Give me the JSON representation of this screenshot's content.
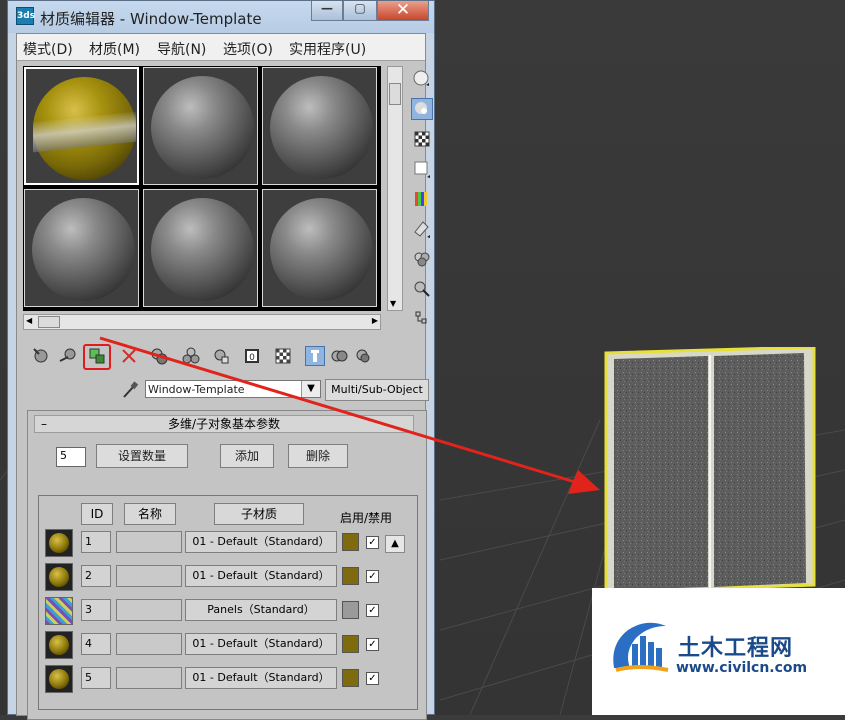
{
  "window": {
    "title": "材质编辑器 - Window-Template",
    "app_icon_text": "3ds",
    "minimize_label": "—",
    "maximize_label": "▢",
    "close_label": "✕"
  },
  "menu": [
    {
      "label": "模式(D)"
    },
    {
      "label": "材质(M)"
    },
    {
      "label": "导航(N)"
    },
    {
      "label": "选项(O)"
    },
    {
      "label": "实用程序(U)"
    }
  ],
  "sample_slots": [
    {
      "material": "gold",
      "selected": true
    },
    {
      "material": "gray",
      "selected": false
    },
    {
      "material": "gray",
      "selected": false
    },
    {
      "material": "gray",
      "selected": false
    },
    {
      "material": "gray",
      "selected": false
    },
    {
      "material": "gray",
      "selected": false
    }
  ],
  "side_toolbar": [
    "sample-type-icon",
    "backlight-icon",
    "background-icon",
    "tiling-icon",
    "video-color-check-icon",
    "make-preview-icon",
    "options-icon",
    "select-by-material-icon",
    "material-map-navigator-icon"
  ],
  "horizontal_toolbar": [
    "get-material-icon",
    "put-to-scene-icon",
    "assign-to-selection-icon",
    "reset-map-icon",
    "copy-material-icon",
    "make-unique-icon",
    "put-to-library-icon",
    "material-id-channel-icon",
    "show-map-icon",
    "show-end-result-icon",
    "go-to-parent-icon",
    "go-forward-icon"
  ],
  "material_name": "Window-Template",
  "material_type": "Multi/Sub-Object",
  "rollout": {
    "title": "多维/子对象基本参数",
    "collapse": "–",
    "count": "5",
    "set_count_label": "设置数量",
    "add_label": "添加",
    "delete_label": "删除",
    "col_id": "ID",
    "col_name": "名称",
    "col_submat": "子材质",
    "col_onoff": "启用/禁用"
  },
  "sub_materials": [
    {
      "id": "1",
      "material": "01 - Default（Standard）",
      "color": "#7e6b0e",
      "enabled": true
    },
    {
      "id": "2",
      "material": "01 - Default（Standard）",
      "color": "#7e6b0e",
      "enabled": true
    },
    {
      "id": "3",
      "material": "Panels（Standard）",
      "color": "#9a9a9a",
      "enabled": true
    },
    {
      "id": "4",
      "material": "01 - Default（Standard）",
      "color": "#7e6b0e",
      "enabled": true
    },
    {
      "id": "5",
      "material": "01 - Default（Standard）",
      "color": "#7e6b0e",
      "enabled": true
    }
  ],
  "check_mark": "✓",
  "watermark": {
    "title": "土木工程网",
    "url": "www.civilcn.com"
  }
}
